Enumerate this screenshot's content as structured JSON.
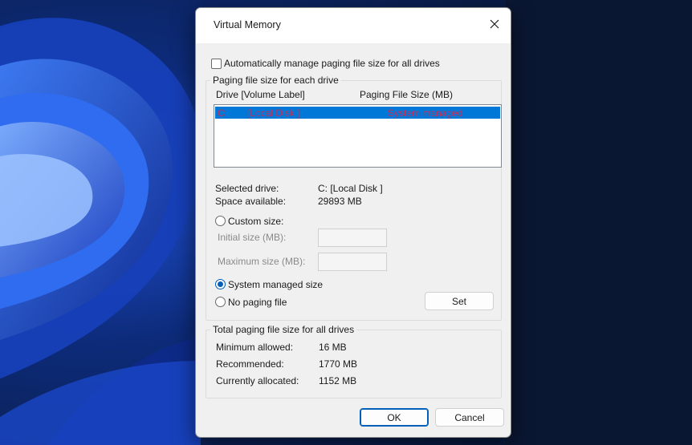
{
  "window": {
    "title": "Virtual Memory"
  },
  "auto_manage": {
    "label": "Automatically manage paging file size for all drives",
    "checked": false
  },
  "per_drive_group": {
    "label": "Paging file size for each drive",
    "col_drive": "Drive  [Volume Label]",
    "col_size": "Paging File Size (MB)",
    "rows": [
      {
        "drive": "C:",
        "volume": "[Local Disk ]",
        "size": "System managed",
        "selected": true
      }
    ]
  },
  "selected_info": {
    "selected_drive_label": "Selected drive:",
    "selected_drive_value": "C:  [Local Disk ]",
    "space_label": "Space available:",
    "space_value": "29893 MB"
  },
  "options": {
    "custom_size": "Custom size:",
    "initial_size": "Initial size (MB):",
    "maximum_size": "Maximum size (MB):",
    "system_managed": "System managed size",
    "no_paging": "No paging file",
    "selected": "system_managed",
    "set_button": "Set"
  },
  "totals_group": {
    "label": "Total paging file size for all drives",
    "minimum_label": "Minimum allowed:",
    "minimum_value": "16 MB",
    "recommended_label": "Recommended:",
    "recommended_value": "1770 MB",
    "allocated_label": "Currently allocated:",
    "allocated_value": "1152 MB"
  },
  "footer": {
    "ok": "OK",
    "cancel": "Cancel"
  },
  "colors": {
    "accent": "#005fb8",
    "selection": "#0078d7"
  }
}
